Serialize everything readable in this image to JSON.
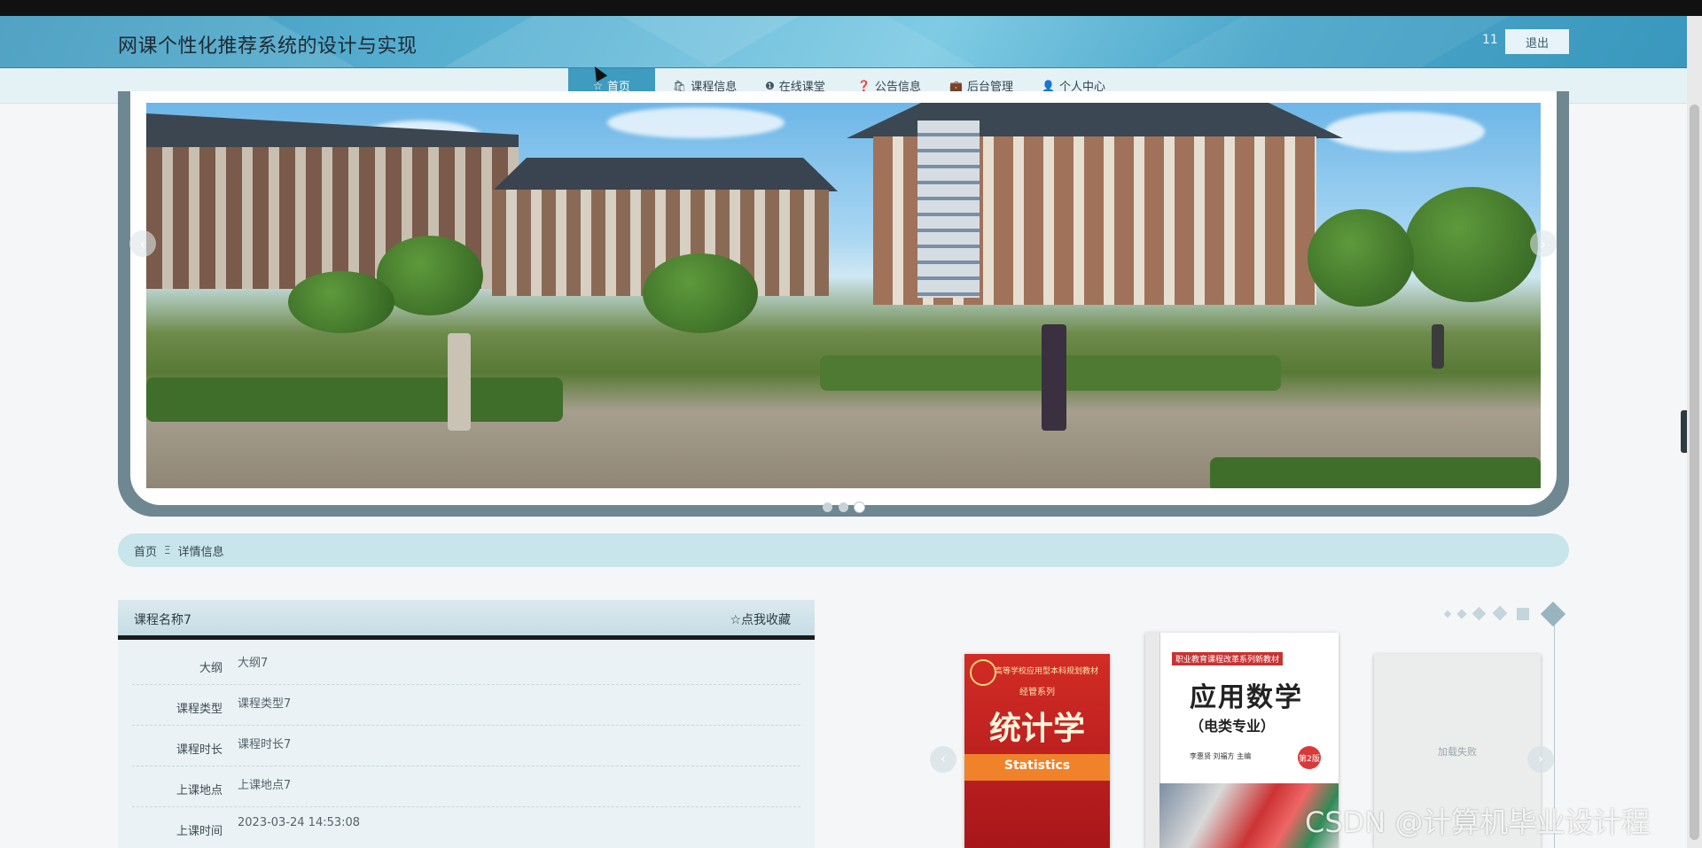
{
  "header": {
    "site_title": "网课个性化推荐系统的设计与实现",
    "user_name": "11",
    "logout_label": "退出"
  },
  "nav": {
    "items": [
      {
        "label": "首页",
        "icon": "star-icon",
        "active": true
      },
      {
        "label": "课程信息",
        "icon": "bag-icon",
        "active": false
      },
      {
        "label": "在线课堂",
        "icon": "info-circle-icon",
        "active": false
      },
      {
        "label": "公告信息",
        "icon": "question-circle-icon",
        "active": false
      },
      {
        "label": "后台管理",
        "icon": "briefcase-icon",
        "active": false
      },
      {
        "label": "个人中心",
        "icon": "user-icon",
        "active": false
      }
    ]
  },
  "carousel": {
    "slide_count": 3,
    "active_slide": 3
  },
  "breadcrumb": {
    "home": "首页",
    "separator": "Ξ",
    "current": "详情信息"
  },
  "detail": {
    "title": "课程名称7",
    "favorite_label": "☆点我收藏",
    "rows": [
      {
        "label": "大纲",
        "value": "大纲7"
      },
      {
        "label": "课程类型",
        "value": "课程类型7"
      },
      {
        "label": "课程时长",
        "value": "课程时长7"
      },
      {
        "label": "上课地点",
        "value": "上课地点7"
      },
      {
        "label": "上课时间",
        "value": "2023-03-24 14:53:08"
      }
    ]
  },
  "gallery": {
    "book1": {
      "top": "高等学校应用型本科规划教材",
      "series": "经管系列",
      "title": "统计学",
      "subtitle": "Statistics"
    },
    "book2": {
      "series": "职业教育课程改革系列新教材",
      "title": "应用数学",
      "subtitle": "（电类专业）",
      "authors": "李惠贤  刘福方  主编",
      "edition": "第2版"
    },
    "book3": {
      "placeholder": "加载失败"
    }
  },
  "watermark": "CSDN @计算机毕业设计程",
  "colors": {
    "header_blue": "#4aa6c9",
    "nav_active": "#3f9bbf",
    "nav_bg": "#e4f2f6",
    "breadcrumb_bg": "#c7e5ea"
  }
}
